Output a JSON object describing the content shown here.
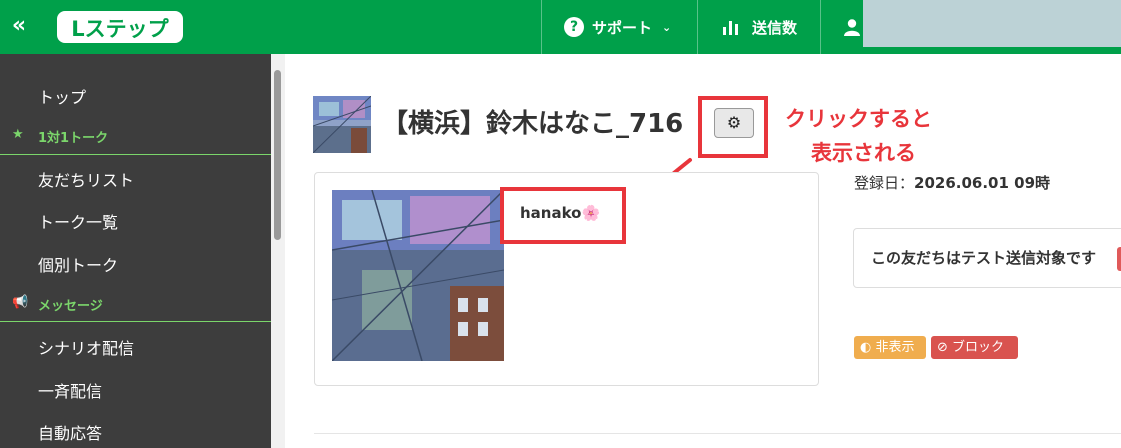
{
  "header": {
    "collapse_icon": "double-chevron-left-icon",
    "logo_text": "Lステップ",
    "nav": {
      "support_label": "サポート",
      "sent_count_label": "送信数",
      "user_icon": "user-icon"
    },
    "colors": {
      "brand": "#00a04a"
    }
  },
  "sidebar": {
    "items": [
      {
        "label": "トップ",
        "type": "item"
      },
      {
        "label": "1対1トーク",
        "type": "category",
        "icon": "star-icon"
      },
      {
        "label": "友だちリスト",
        "type": "item"
      },
      {
        "label": "トーク一覧",
        "type": "item"
      },
      {
        "label": "個別トーク",
        "type": "item"
      },
      {
        "label": "メッセージ",
        "type": "category",
        "icon": "megaphone-icon"
      },
      {
        "label": "シナリオ配信",
        "type": "item"
      },
      {
        "label": "一斉配信",
        "type": "item"
      },
      {
        "label": "自動応答",
        "type": "item"
      }
    ],
    "colors": {
      "background": "#3d3d3d",
      "category": "#7bd66b"
    }
  },
  "main": {
    "title": "【横浜】鈴木はなこ_716",
    "settings_icon": "gear-icon",
    "annotation": {
      "line1": "クリックすると",
      "line2": "表示される",
      "color": "#e8353b"
    },
    "profile": {
      "nickname": "hanako🌸"
    },
    "registration": {
      "label": "登録日：",
      "value": "2026.06.01 09時"
    },
    "test_notice": "この友だちはテスト送信対象です",
    "tags": {
      "hide_label": "非表示",
      "block_label": "ブロック"
    }
  }
}
